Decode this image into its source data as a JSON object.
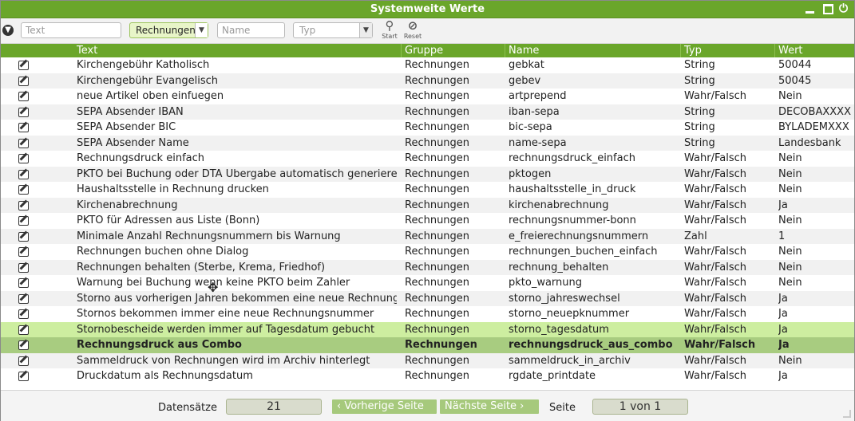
{
  "window": {
    "title": "Systemweite Werte",
    "controls": [
      "minimize-icon",
      "maximize-icon",
      "power-icon"
    ],
    "accent_color": "#6aa62a"
  },
  "toolbar": {
    "text_placeholder": "Text",
    "group_selected": "Rechnungen",
    "name_placeholder": "Name",
    "type_placeholder": "Typ",
    "start_label": "Start",
    "reset_label": "Reset"
  },
  "columns": {
    "text": "Text",
    "gruppe": "Gruppe",
    "name": "Name",
    "typ": "Typ",
    "wert": "Wert"
  },
  "rows": [
    {
      "text": "Kirchengebühr Katholisch",
      "gruppe": "Rechnungen",
      "name": "gebkat",
      "typ": "String",
      "wert": "50044"
    },
    {
      "text": "Kirchengebühr Evangelisch",
      "gruppe": "Rechnungen",
      "name": "gebev",
      "typ": "String",
      "wert": "50045"
    },
    {
      "text": "neue Artikel oben einfuegen",
      "gruppe": "Rechnungen",
      "name": "artprepend",
      "typ": "Wahr/Falsch",
      "wert": "Nein"
    },
    {
      "text": "SEPA Absender IBAN",
      "gruppe": "Rechnungen",
      "name": "iban-sepa",
      "typ": "String",
      "wert": "DECOBAXXXX"
    },
    {
      "text": "SEPA Absender BIC",
      "gruppe": "Rechnungen",
      "name": "bic-sepa",
      "typ": "String",
      "wert": "BYLADEMXXX"
    },
    {
      "text": "SEPA Absender Name",
      "gruppe": "Rechnungen",
      "name": "name-sepa",
      "typ": "String",
      "wert": "Landesbank"
    },
    {
      "text": "Rechnungsdruck einfach",
      "gruppe": "Rechnungen",
      "name": "rechnungsdruck_einfach",
      "typ": "Wahr/Falsch",
      "wert": "Nein"
    },
    {
      "text": "PKTO bei Buchung oder DTA Übergabe automatisch generiere",
      "gruppe": "Rechnungen",
      "name": "pktogen",
      "typ": "Wahr/Falsch",
      "wert": "Nein"
    },
    {
      "text": "Haushaltsstelle in Rechnung drucken",
      "gruppe": "Rechnungen",
      "name": "haushaltsstelle_in_druck",
      "typ": "Wahr/Falsch",
      "wert": "Nein"
    },
    {
      "text": "Kirchenabrechnung",
      "gruppe": "Rechnungen",
      "name": "kirchenabrechnung",
      "typ": "Wahr/Falsch",
      "wert": "Ja"
    },
    {
      "text": "PKTO für Adressen aus Liste (Bonn)",
      "gruppe": "Rechnungen",
      "name": "rechnungsnummer-bonn",
      "typ": "Wahr/Falsch",
      "wert": "Nein"
    },
    {
      "text": "Minimale Anzahl Rechnungsnummern bis Warnung",
      "gruppe": "Rechnungen",
      "name": "e_freierechnungsnummern",
      "typ": "Zahl",
      "wert": "1"
    },
    {
      "text": "Rechnungen buchen ohne Dialog",
      "gruppe": "Rechnungen",
      "name": "rechnungen_buchen_einfach",
      "typ": "Wahr/Falsch",
      "wert": "Nein"
    },
    {
      "text": "Rechnungen behalten (Sterbe, Krema, Friedhof)",
      "gruppe": "Rechnungen",
      "name": "rechnung_behalten",
      "typ": "Wahr/Falsch",
      "wert": "Nein"
    },
    {
      "text": "Warnung bei Buchung wenn keine PKTO beim Zahler",
      "gruppe": "Rechnungen",
      "name": "pkto_warnung",
      "typ": "Wahr/Falsch",
      "wert": "Nein"
    },
    {
      "text": "Storno aus vorherigen Jahren bekommen eine neue Rechnung",
      "gruppe": "Rechnungen",
      "name": "storno_jahreswechsel",
      "typ": "Wahr/Falsch",
      "wert": "Ja"
    },
    {
      "text": "Stornos bekommen immer eine neue Rechnungsnummer",
      "gruppe": "Rechnungen",
      "name": "storno_neuepknummer",
      "typ": "Wahr/Falsch",
      "wert": "Ja"
    },
    {
      "text": "Stornobescheide werden immer auf Tagesdatum gebucht",
      "gruppe": "Rechnungen",
      "name": "storno_tagesdatum",
      "typ": "Wahr/Falsch",
      "wert": "Ja"
    },
    {
      "text": "Rechnungsdruck aus Combo",
      "gruppe": "Rechnungen",
      "name": "rechnungsdruck_aus_combo",
      "typ": "Wahr/Falsch",
      "wert": "Ja"
    },
    {
      "text": "Sammeldruck von Rechnungen wird im Archiv hinterlegt",
      "gruppe": "Rechnungen",
      "name": "sammeldruck_in_archiv",
      "typ": "Wahr/Falsch",
      "wert": "Nein"
    },
    {
      "text": "Druckdatum als Rechnungsdatum",
      "gruppe": "Rechnungen",
      "name": "rgdate_printdate",
      "typ": "Wahr/Falsch",
      "wert": "Ja"
    }
  ],
  "hover_row": 17,
  "selected_row": 18,
  "footer": {
    "records_label": "Datensätze",
    "records_count": "21",
    "prev_label": "‹ Vorherige Seite",
    "next_label": "Nächste Seite ›",
    "page_label": "Seite",
    "page_value": "1 von 1"
  }
}
